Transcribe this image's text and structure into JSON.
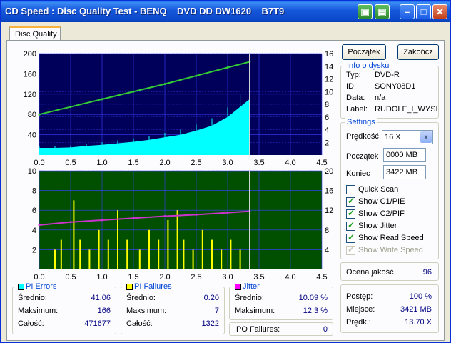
{
  "window": {
    "title": "CD Speed : Disc Quality Test - BENQ    DVD DD DW1620    B7T9"
  },
  "tab": {
    "label": "Disc Quality"
  },
  "buttons": {
    "start": "Początek",
    "end": "Zakończ"
  },
  "disc_info": {
    "title": "Info o dysku",
    "rows": [
      {
        "label": "Typ:",
        "value": "DVD-R"
      },
      {
        "label": "ID:",
        "value": "SONY08D1"
      },
      {
        "label": "Data:",
        "value": "n/a"
      },
      {
        "label": "Label:",
        "value": "RUDOLF_I_WYSP"
      }
    ]
  },
  "settings": {
    "title": "Settings",
    "speed_label": "Prędkość",
    "speed_value": "16 X",
    "start_label": "Początek",
    "start_value": "0000 MB",
    "end_label": "Koniec",
    "end_value": "3422 MB",
    "checks": [
      {
        "label": "Quick Scan",
        "checked": false,
        "disabled": false
      },
      {
        "label": "Show C1/PIE",
        "checked": true,
        "disabled": false
      },
      {
        "label": "Show C2/PIF",
        "checked": true,
        "disabled": false
      },
      {
        "label": "Show Jitter",
        "checked": true,
        "disabled": false
      },
      {
        "label": "Show Read Speed",
        "checked": true,
        "disabled": false
      },
      {
        "label": "Show Write Speed",
        "checked": true,
        "disabled": true
      }
    ]
  },
  "quality": {
    "label": "Ocena jakość",
    "value": "96"
  },
  "progress": {
    "rows": [
      {
        "label": "Postęp:",
        "value": "100 %"
      },
      {
        "label": "Miejsce:",
        "value": "3421 MB"
      },
      {
        "label": "Prędk.:",
        "value": "13.70 X"
      }
    ]
  },
  "pi_errors": {
    "title": "PI Errors",
    "color": "#00ffff",
    "rows": [
      {
        "label": "Średnio:",
        "value": "41.06"
      },
      {
        "label": "Maksimum:",
        "value": "166"
      },
      {
        "label": "Całość:",
        "value": "471677"
      }
    ]
  },
  "pi_failures": {
    "title": "PI Failures",
    "color": "#ffff00",
    "rows": [
      {
        "label": "Średnio:",
        "value": "0.20"
      },
      {
        "label": "Maksimum:",
        "value": "7"
      },
      {
        "label": "Całość:",
        "value": "1322"
      }
    ]
  },
  "jitter": {
    "title": "Jitter",
    "color": "#ff00ff",
    "rows": [
      {
        "label": "Średnio:",
        "value": "10.09 %"
      },
      {
        "label": "Maksimum:",
        "value": "12.3 %"
      }
    ],
    "po_label": "PO Failures:",
    "po_value": "0"
  },
  "chart_data": [
    {
      "type": "area",
      "x_ticks": [
        "0.0",
        "0.5",
        "1.0",
        "1.5",
        "2.0",
        "2.5",
        "3.0",
        "3.5",
        "4.0",
        "4.5"
      ],
      "y_left_ticks": [
        "200",
        "160",
        "120",
        "80",
        "40"
      ],
      "y_right_ticks": [
        "16",
        "14",
        "12",
        "10",
        "8",
        "6",
        "4",
        "2"
      ],
      "xlim": [
        0,
        4.5
      ],
      "ylim": [
        0,
        200
      ],
      "y2lim": [
        0,
        16
      ],
      "grid": true,
      "series": [
        {
          "color": "#00ffff",
          "x": [
            0.0,
            0.25,
            0.5,
            0.75,
            1.0,
            1.25,
            1.5,
            1.75,
            2.0,
            2.25,
            2.5,
            2.75,
            3.0,
            3.2,
            3.35
          ],
          "values": [
            14,
            14,
            15,
            18,
            20,
            23,
            26,
            30,
            35,
            40,
            48,
            58,
            75,
            95,
            110
          ]
        },
        {
          "color": "#33cc33",
          "x": [
            0.0,
            0.5,
            1.0,
            1.5,
            2.0,
            2.5,
            3.0,
            3.35
          ],
          "values": [
            6.4,
            7.6,
            8.8,
            10.0,
            11.2,
            12.5,
            13.8,
            14.7
          ]
        }
      ]
    },
    {
      "type": "bar",
      "x_ticks": [
        "0.0",
        "0.5",
        "1.0",
        "1.5",
        "2.0",
        "2.5",
        "3.0",
        "3.5",
        "4.0",
        "4.5"
      ],
      "y_left_ticks": [
        "10",
        "8",
        "6",
        "4",
        "2"
      ],
      "y_right_ticks": [
        "20",
        "16",
        "12",
        "8",
        "4"
      ],
      "xlim": [
        0,
        4.5
      ],
      "ylim": [
        0,
        10
      ],
      "y2lim": [
        0,
        20
      ],
      "grid": true,
      "series": [
        {
          "color": "#ffff00",
          "x": [
            0.25,
            0.35,
            0.55,
            0.65,
            0.8,
            0.95,
            1.1,
            1.25,
            1.4,
            1.6,
            1.75,
            1.9,
            2.05,
            2.2,
            2.3,
            2.45,
            2.6,
            2.75,
            2.9,
            3.05,
            3.2
          ],
          "values": [
            2,
            3,
            7,
            3,
            2,
            4,
            3,
            6,
            3,
            2,
            4,
            3,
            5,
            6,
            3,
            2,
            4,
            3,
            2,
            3,
            2
          ]
        },
        {
          "color": "#cc33cc",
          "x": [
            0.0,
            0.5,
            1.0,
            1.5,
            2.0,
            2.5,
            3.0,
            3.35
          ],
          "values": [
            9.0,
            9.6,
            10.0,
            10.4,
            10.8,
            11.1,
            11.5,
            11.8
          ]
        }
      ]
    }
  ]
}
